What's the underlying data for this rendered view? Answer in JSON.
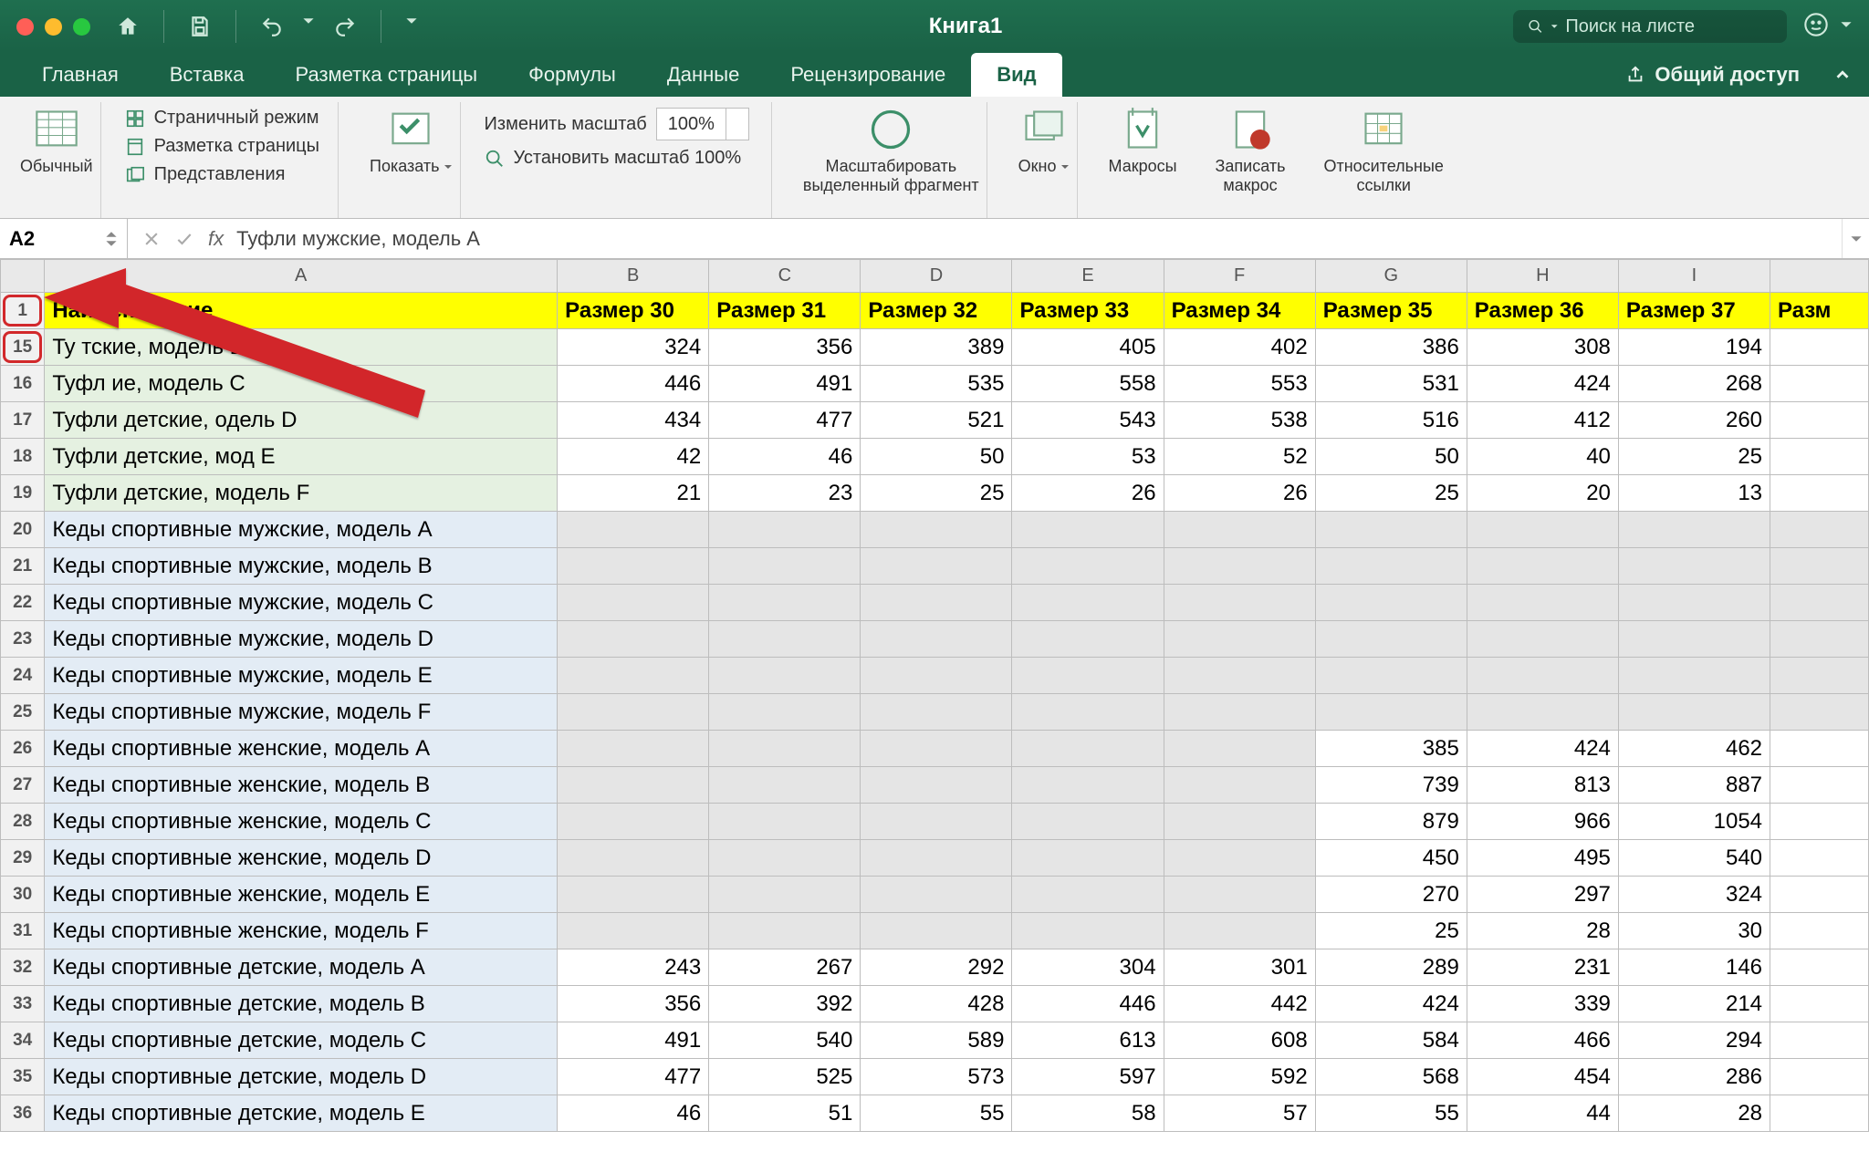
{
  "title": "Книга1",
  "search": {
    "placeholder": "Поиск на листе"
  },
  "tabs": [
    "Главная",
    "Вставка",
    "Разметка страницы",
    "Формулы",
    "Данные",
    "Рецензирование",
    "Вид"
  ],
  "active_tab": "Вид",
  "share_label": "Общий доступ",
  "ribbon": {
    "normal": "Обычный",
    "page_break": "Страничный режим",
    "page_layout": "Разметка страницы",
    "custom_views": "Представления",
    "show": "Показать",
    "zoom_label": "Изменить масштаб",
    "zoom_value": "100%",
    "zoom_100": "Установить масштаб 100%",
    "zoom_selection_1": "Масштабировать",
    "zoom_selection_2": "выделенный фрагмент",
    "window": "Окно",
    "macros": "Макросы",
    "record_macro_1": "Записать",
    "record_macro_2": "макрос",
    "relative_refs_1": "Относительные",
    "relative_refs_2": "ссылки"
  },
  "formula_bar": {
    "name_box": "A2",
    "formula": "Туфли мужские, модель А"
  },
  "columns": [
    "A",
    "B",
    "C",
    "D",
    "E",
    "F",
    "G",
    "H",
    "I"
  ],
  "last_col_partial": "Разм",
  "header_row": {
    "num": "1",
    "cells": [
      "Наименование",
      "Размер 30",
      "Размер 31",
      "Размер 32",
      "Размер 33",
      "Размер 34",
      "Размер 35",
      "Размер 36",
      "Размер 37"
    ]
  },
  "data_rows": [
    {
      "num": "15",
      "style": "green",
      "cells": [
        "Ту              тские, модель B",
        "324",
        "356",
        "389",
        "405",
        "402",
        "386",
        "308",
        "194"
      ]
    },
    {
      "num": "16",
      "style": "green",
      "cells": [
        "Туфл            ие, модель C",
        "446",
        "491",
        "535",
        "558",
        "553",
        "531",
        "424",
        "268"
      ]
    },
    {
      "num": "17",
      "style": "green",
      "cells": [
        "Туфли детские,       одель D",
        "434",
        "477",
        "521",
        "543",
        "538",
        "516",
        "412",
        "260"
      ]
    },
    {
      "num": "18",
      "style": "green",
      "cells": [
        "Туфли детские, мод       E",
        "42",
        "46",
        "50",
        "53",
        "52",
        "50",
        "40",
        "25"
      ]
    },
    {
      "num": "19",
      "style": "green",
      "cells": [
        "Туфли детские, модель F",
        "21",
        "23",
        "25",
        "26",
        "26",
        "25",
        "20",
        "13"
      ]
    },
    {
      "num": "20",
      "style": "blue",
      "cells": [
        "Кеды спортивные мужские, модель A",
        "",
        "",
        "",
        "",
        "",
        "",
        "",
        ""
      ],
      "grey": [
        1,
        2,
        3,
        4,
        5,
        6,
        7,
        8
      ]
    },
    {
      "num": "21",
      "style": "blue",
      "cells": [
        "Кеды спортивные мужские, модель B",
        "",
        "",
        "",
        "",
        "",
        "",
        "",
        ""
      ],
      "grey": [
        1,
        2,
        3,
        4,
        5,
        6,
        7,
        8
      ]
    },
    {
      "num": "22",
      "style": "blue",
      "cells": [
        "Кеды спортивные мужские, модель C",
        "",
        "",
        "",
        "",
        "",
        "",
        "",
        ""
      ],
      "grey": [
        1,
        2,
        3,
        4,
        5,
        6,
        7,
        8
      ]
    },
    {
      "num": "23",
      "style": "blue",
      "cells": [
        "Кеды спортивные мужские, модель D",
        "",
        "",
        "",
        "",
        "",
        "",
        "",
        ""
      ],
      "grey": [
        1,
        2,
        3,
        4,
        5,
        6,
        7,
        8
      ]
    },
    {
      "num": "24",
      "style": "blue",
      "cells": [
        "Кеды спортивные мужские, модель E",
        "",
        "",
        "",
        "",
        "",
        "",
        "",
        ""
      ],
      "grey": [
        1,
        2,
        3,
        4,
        5,
        6,
        7,
        8
      ]
    },
    {
      "num": "25",
      "style": "blue",
      "cells": [
        "Кеды спортивные мужские, модель F",
        "",
        "",
        "",
        "",
        "",
        "",
        "",
        ""
      ],
      "grey": [
        1,
        2,
        3,
        4,
        5,
        6,
        7,
        8
      ]
    },
    {
      "num": "26",
      "style": "blue",
      "cells": [
        "Кеды спортивные женские, модель A",
        "",
        "",
        "",
        "",
        "",
        "385",
        "424",
        "462"
      ],
      "grey": [
        1,
        2,
        3,
        4,
        5
      ]
    },
    {
      "num": "27",
      "style": "blue",
      "cells": [
        "Кеды спортивные женские, модель B",
        "",
        "",
        "",
        "",
        "",
        "739",
        "813",
        "887"
      ],
      "grey": [
        1,
        2,
        3,
        4,
        5
      ]
    },
    {
      "num": "28",
      "style": "blue",
      "cells": [
        "Кеды спортивные женские, модель C",
        "",
        "",
        "",
        "",
        "",
        "879",
        "966",
        "1054"
      ],
      "grey": [
        1,
        2,
        3,
        4,
        5
      ]
    },
    {
      "num": "29",
      "style": "blue",
      "cells": [
        "Кеды спортивные женские, модель D",
        "",
        "",
        "",
        "",
        "",
        "450",
        "495",
        "540"
      ],
      "grey": [
        1,
        2,
        3,
        4,
        5
      ]
    },
    {
      "num": "30",
      "style": "blue",
      "cells": [
        "Кеды спортивные женские, модель E",
        "",
        "",
        "",
        "",
        "",
        "270",
        "297",
        "324"
      ],
      "grey": [
        1,
        2,
        3,
        4,
        5
      ]
    },
    {
      "num": "31",
      "style": "blue",
      "cells": [
        "Кеды спортивные женские, модель F",
        "",
        "",
        "",
        "",
        "",
        "25",
        "28",
        "30"
      ],
      "grey": [
        1,
        2,
        3,
        4,
        5
      ]
    },
    {
      "num": "32",
      "style": "blue",
      "cells": [
        "Кеды спортивные детские, модель A",
        "243",
        "267",
        "292",
        "304",
        "301",
        "289",
        "231",
        "146"
      ]
    },
    {
      "num": "33",
      "style": "blue",
      "cells": [
        "Кеды спортивные детские, модель B",
        "356",
        "392",
        "428",
        "446",
        "442",
        "424",
        "339",
        "214"
      ]
    },
    {
      "num": "34",
      "style": "blue",
      "cells": [
        "Кеды спортивные детские, модель C",
        "491",
        "540",
        "589",
        "613",
        "608",
        "584",
        "466",
        "294"
      ]
    },
    {
      "num": "35",
      "style": "blue",
      "cells": [
        "Кеды спортивные детские, модель D",
        "477",
        "525",
        "573",
        "597",
        "592",
        "568",
        "454",
        "286"
      ]
    },
    {
      "num": "36",
      "style": "blue",
      "cells": [
        "Кеды спортивные детские, модель E",
        "46",
        "51",
        "55",
        "58",
        "57",
        "55",
        "44",
        "28"
      ]
    }
  ]
}
